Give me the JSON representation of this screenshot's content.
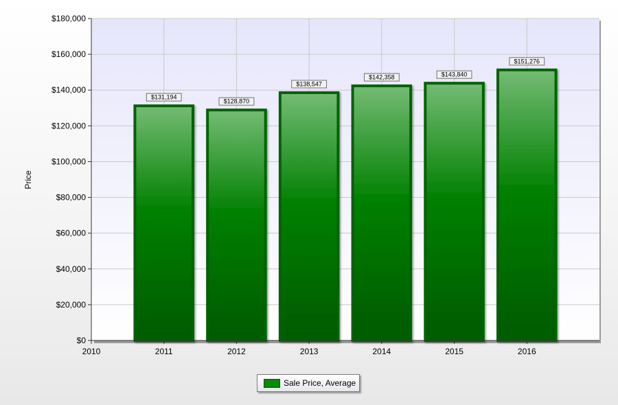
{
  "chart_data": {
    "type": "bar",
    "title": "",
    "xlabel": "",
    "ylabel": "Price",
    "x_ticks": [
      "2010",
      "2011",
      "2012",
      "2013",
      "2014",
      "2015",
      "2016"
    ],
    "categories": [
      "2011",
      "2012",
      "2013",
      "2014",
      "2015",
      "2016"
    ],
    "series": [
      {
        "name": "Sale Price, Average",
        "values": [
          131194,
          128870,
          138547,
          142358,
          143840,
          151276
        ],
        "labels": [
          "$131,194",
          "$128,870",
          "$138,547",
          "$142,358",
          "$143,840",
          "$151,276"
        ],
        "color": "#008000"
      }
    ],
    "ylim": [
      0,
      180000
    ],
    "y_ticks": [
      "$0",
      "$20,000",
      "$40,000",
      "$60,000",
      "$80,000",
      "$100,000",
      "$120,000",
      "$140,000",
      "$160,000",
      "$180,000"
    ],
    "grid": true,
    "legend_position": "bottom-center",
    "plot_background": "#e8e8fa"
  }
}
